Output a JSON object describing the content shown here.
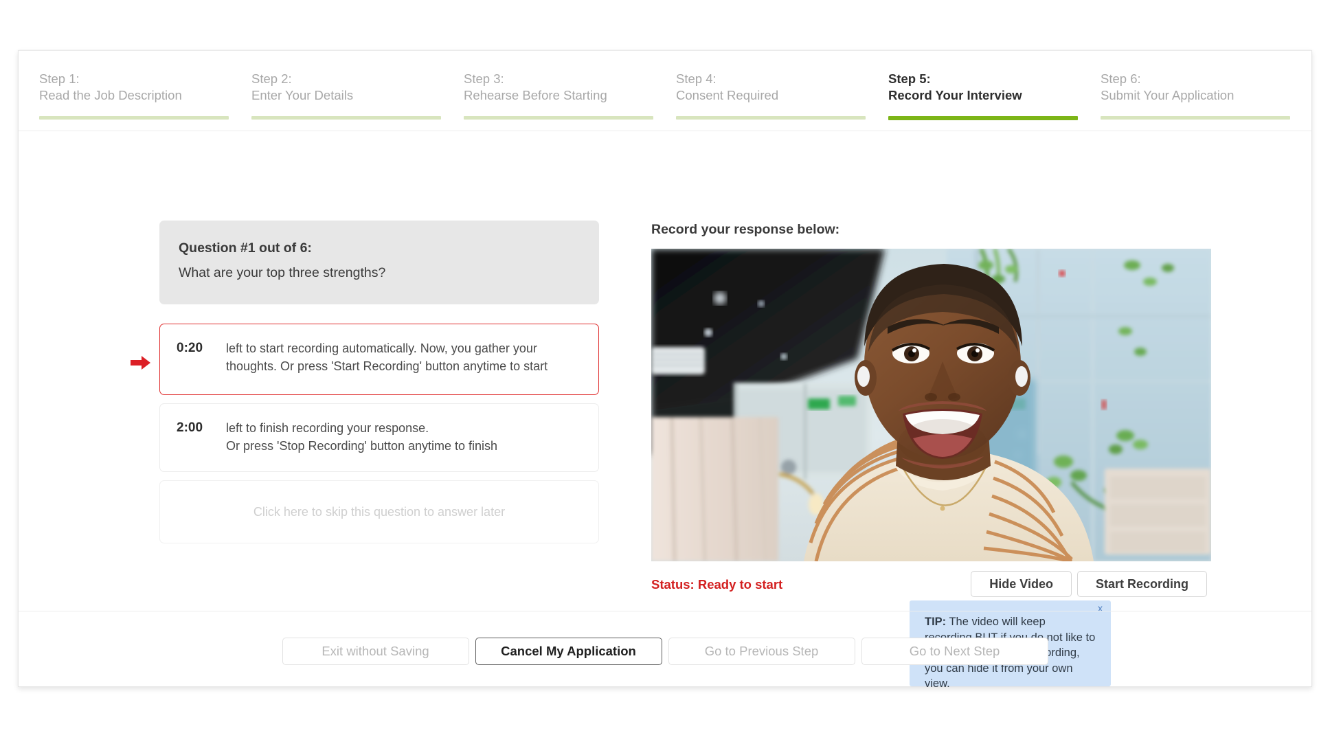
{
  "steps": [
    {
      "num": "Step 1:",
      "title": "Read the Job Description",
      "active": false
    },
    {
      "num": "Step 2:",
      "title": "Enter Your Details",
      "active": false
    },
    {
      "num": "Step 3:",
      "title": "Rehearse Before Starting",
      "active": false
    },
    {
      "num": "Step 4:",
      "title": "Consent Required",
      "active": false
    },
    {
      "num": "Step 5:",
      "title": "Record Your Interview",
      "active": true
    },
    {
      "num": "Step 6:",
      "title": "Submit Your Application",
      "active": false
    }
  ],
  "question": {
    "label": "Question #1 out of 6:",
    "text": "What are your top three strengths?"
  },
  "timers": [
    {
      "value": "0:20",
      "line1": "left to start recording automatically. Now, you gather your",
      "line2": "thoughts. Or press 'Start Recording' button anytime to start",
      "highlight": true
    },
    {
      "value": "2:00",
      "line1": "left to finish recording your response.",
      "line2": "Or press 'Stop Recording' button anytime to finish",
      "highlight": false
    }
  ],
  "skip": {
    "text": "Click here to skip this question to answer later"
  },
  "recorder": {
    "heading": "Record your response below:",
    "status": "Status: Ready to start",
    "hide_video_label": "Hide Video",
    "start_recording_label": "Start Recording"
  },
  "tip": {
    "close_label": "x",
    "prefix": "TIP:",
    "text": " The video will keep recording BUT if you do not like to watch yourself while recording, you can hide it from your own view."
  },
  "footer": {
    "exit_label": "Exit without Saving",
    "cancel_label": "Cancel My Application",
    "previous_label": "Go to Previous Step",
    "next_label": "Go to Next Step"
  },
  "colors": {
    "step_active_bar": "#7cb518",
    "step_inactive_bar": "#d8e5be",
    "status_red": "#d32020",
    "tip_background": "#cfe2f8",
    "arrow_red": "#dc1f26"
  }
}
